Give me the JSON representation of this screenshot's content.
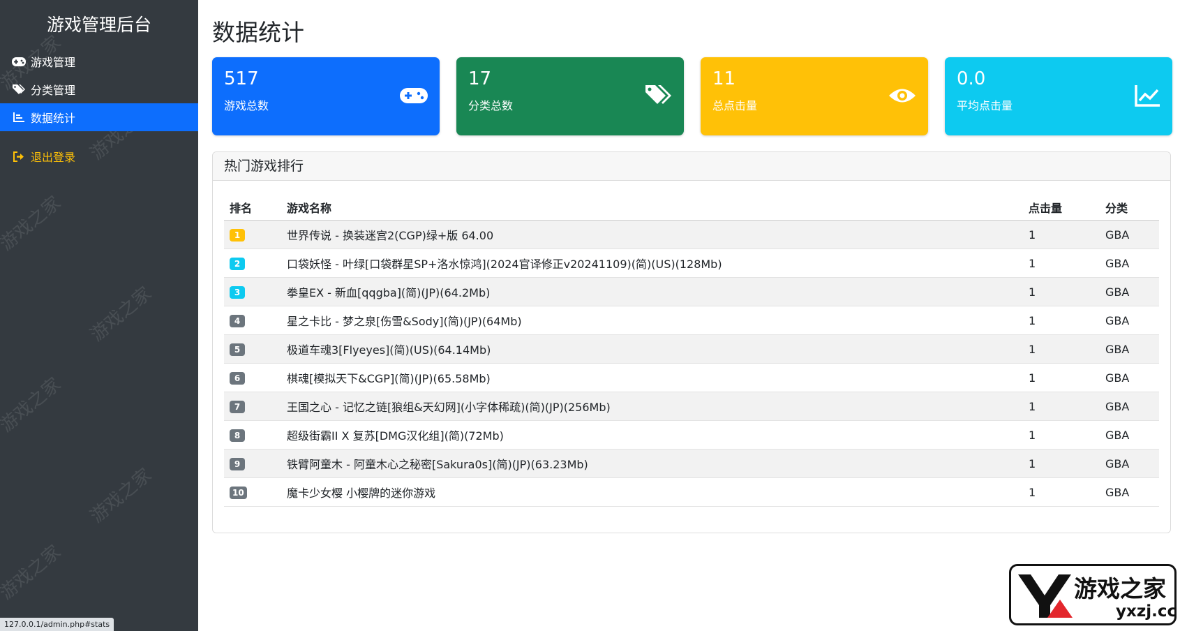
{
  "sidebar": {
    "brand": "游戏管理后台",
    "items": [
      {
        "label": "游戏管理",
        "icon": "gamepad-icon"
      },
      {
        "label": "分类管理",
        "icon": "tags-icon"
      },
      {
        "label": "数据统计",
        "icon": "chart-icon",
        "active": true
      }
    ],
    "logout": "退出登录",
    "status_url": "127.0.0.1/admin.php#stats"
  },
  "main": {
    "title": "数据统计",
    "cards": [
      {
        "value": "517",
        "label": "游戏总数",
        "color": "#0d6efd",
        "icon": "gamepad-icon"
      },
      {
        "value": "17",
        "label": "分类总数",
        "color": "#198754",
        "icon": "tags-icon"
      },
      {
        "value": "11",
        "label": "总点击量",
        "color": "#ffc107",
        "icon": "eye-icon"
      },
      {
        "value": "0.0",
        "label": "平均点击量",
        "color": "#0dcaf0",
        "icon": "chart-line-icon"
      }
    ],
    "panel": {
      "title": "热门游戏排行",
      "headers": [
        "排名",
        "游戏名称",
        "点击量",
        "分类"
      ],
      "rows": [
        {
          "rank": "1",
          "name": "世界传说 - 换装迷宫2(CGP)绿+版 64.00",
          "clicks": "1",
          "category": "GBA",
          "badge_color": "#ffc107"
        },
        {
          "rank": "2",
          "name": "口袋妖怪 - 叶绿[口袋群星SP+洛水惊鸿](2024官译修正v20241109)(简)(US)(128Mb)",
          "clicks": "1",
          "category": "GBA",
          "badge_color": "#0dcaf0"
        },
        {
          "rank": "3",
          "name": "拳皇EX - 新血[qqgba](简)(JP)(64.2Mb)",
          "clicks": "1",
          "category": "GBA",
          "badge_color": "#0dcaf0"
        },
        {
          "rank": "4",
          "name": "星之卡比 - 梦之泉[伤雪&Sody](简)(JP)(64Mb)",
          "clicks": "1",
          "category": "GBA",
          "badge_color": "#6c757d"
        },
        {
          "rank": "5",
          "name": "极道车魂3[Flyeyes](简)(US)(64.14Mb)",
          "clicks": "1",
          "category": "GBA",
          "badge_color": "#6c757d"
        },
        {
          "rank": "6",
          "name": "棋魂[模拟天下&CGP](简)(JP)(65.58Mb)",
          "clicks": "1",
          "category": "GBA",
          "badge_color": "#6c757d"
        },
        {
          "rank": "7",
          "name": "王国之心 - 记忆之链[狼组&天幻网](小字体稀疏)(简)(JP)(256Mb)",
          "clicks": "1",
          "category": "GBA",
          "badge_color": "#6c757d"
        },
        {
          "rank": "8",
          "name": "超级街霸II X 复苏[DMG汉化组](简)(72Mb)",
          "clicks": "1",
          "category": "GBA",
          "badge_color": "#6c757d"
        },
        {
          "rank": "9",
          "name": "铁臂阿童木 - 阿童木心之秘密[Sakura0s](简)(JP)(63.23Mb)",
          "clicks": "1",
          "category": "GBA",
          "badge_color": "#6c757d"
        },
        {
          "rank": "10",
          "name": "魔卡少女樱 小樱牌的迷你游戏",
          "clicks": "1",
          "category": "GBA",
          "badge_color": "#6c757d"
        }
      ]
    }
  },
  "logo": {
    "text": "游戏之家",
    "domain": "yxzj.cc"
  }
}
